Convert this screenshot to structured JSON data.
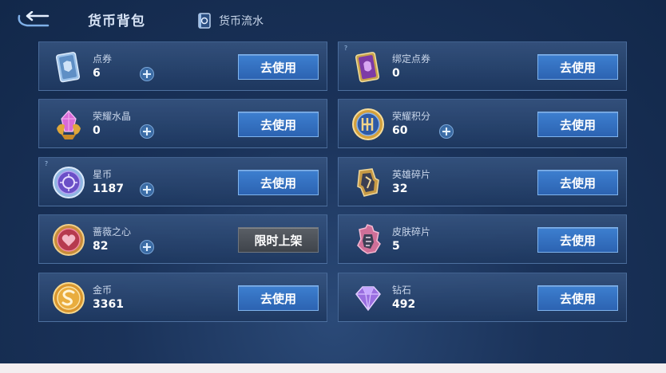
{
  "header": {
    "title": "货币背包",
    "ledger_label": "货币流水"
  },
  "left": [
    {
      "name": "点券",
      "value": "6",
      "icon": "coupon-icon",
      "has_plus": true,
      "button": "去使用",
      "button_style": "blue"
    },
    {
      "name": "荣耀水晶",
      "value": "0",
      "icon": "glory-crystal-icon",
      "has_plus": true,
      "button": "去使用",
      "button_style": "blue"
    },
    {
      "name": "星币",
      "value": "1187",
      "icon": "star-coin-icon",
      "has_plus": true,
      "button": "去使用",
      "button_style": "blue",
      "help": "?"
    },
    {
      "name": "蔷薇之心",
      "value": "82",
      "icon": "rose-heart-icon",
      "has_plus": true,
      "button": "限时上架",
      "button_style": "dark"
    },
    {
      "name": "金币",
      "value": "3361",
      "icon": "gold-coin-icon",
      "has_plus": false,
      "button": "去使用",
      "button_style": "blue"
    }
  ],
  "right": [
    {
      "name": "绑定点券",
      "value": "0",
      "icon": "bound-coupon-icon",
      "has_plus": false,
      "button": "去使用",
      "button_style": "blue",
      "help": "?"
    },
    {
      "name": "荣耀积分",
      "value": "60",
      "icon": "glory-points-icon",
      "has_plus": true,
      "button": "去使用",
      "button_style": "blue"
    },
    {
      "name": "英雄碎片",
      "value": "32",
      "icon": "hero-fragment-icon",
      "has_plus": false,
      "button": "去使用",
      "button_style": "blue"
    },
    {
      "name": "皮肤碎片",
      "value": "5",
      "icon": "skin-fragment-icon",
      "has_plus": false,
      "button": "去使用",
      "button_style": "blue"
    },
    {
      "name": "钻石",
      "value": "492",
      "icon": "diamond-icon",
      "has_plus": false,
      "button": "去使用",
      "button_style": "blue"
    }
  ]
}
